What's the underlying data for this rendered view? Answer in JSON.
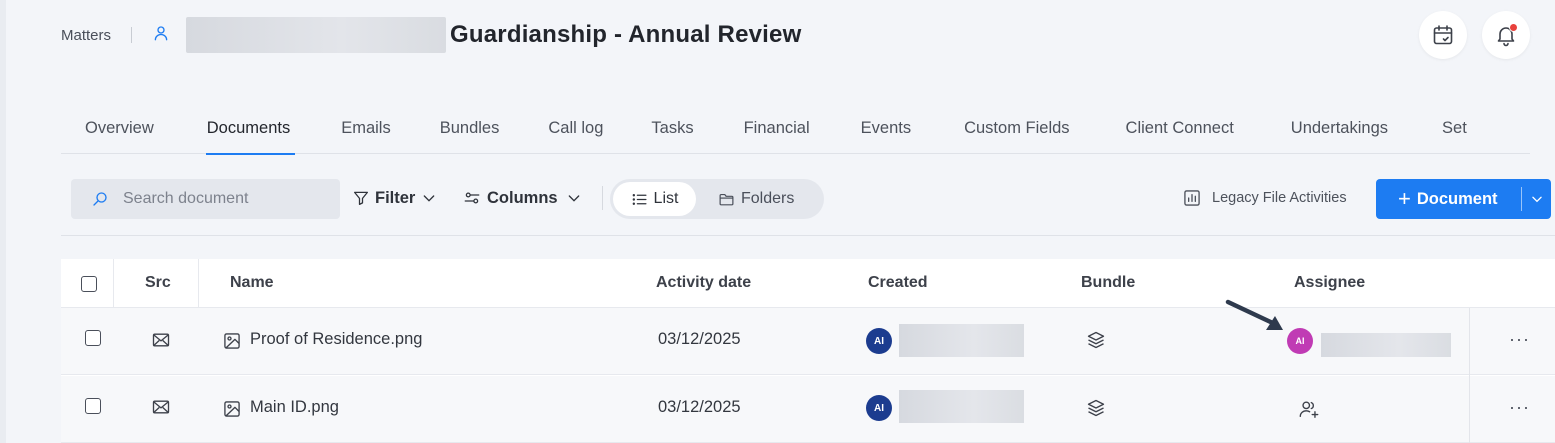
{
  "header": {
    "breadcrumb_root": "Matters",
    "matter_title": "Guardianship - Annual Review"
  },
  "tabs": [
    {
      "label": "Overview"
    },
    {
      "label": "Documents"
    },
    {
      "label": "Emails"
    },
    {
      "label": "Bundles"
    },
    {
      "label": "Call log"
    },
    {
      "label": "Tasks"
    },
    {
      "label": "Financial"
    },
    {
      "label": "Events"
    },
    {
      "label": "Custom Fields"
    },
    {
      "label": "Client Connect"
    },
    {
      "label": "Undertakings"
    },
    {
      "label": "Set"
    }
  ],
  "active_tab": "Documents",
  "toolbar": {
    "search_placeholder": "Search document",
    "filter_label": "Filter",
    "columns_label": "Columns",
    "view_list_label": "List",
    "view_folders_label": "Folders",
    "legacy_label": "Legacy File Activities",
    "document_button_label": "Document"
  },
  "table": {
    "columns": {
      "src": "Src",
      "name": "Name",
      "activity_date": "Activity date",
      "created": "Created",
      "bundle": "Bundle",
      "assignee": "Assignee"
    },
    "rows": [
      {
        "name": "Proof of Residence.png",
        "activity_date": "03/12/2025",
        "created_initials": "AI",
        "assignee_initials": "AI",
        "more": "···"
      },
      {
        "name": "Main ID.png",
        "activity_date": "03/12/2025",
        "created_initials": "AI",
        "assignee_initials": "",
        "more": "···"
      }
    ]
  },
  "colors": {
    "accent": "#1d7cf2",
    "created_avatar": "#1c3c8f",
    "assignee_avatar": "#c03bb4",
    "notification_dot": "#e8413c"
  }
}
